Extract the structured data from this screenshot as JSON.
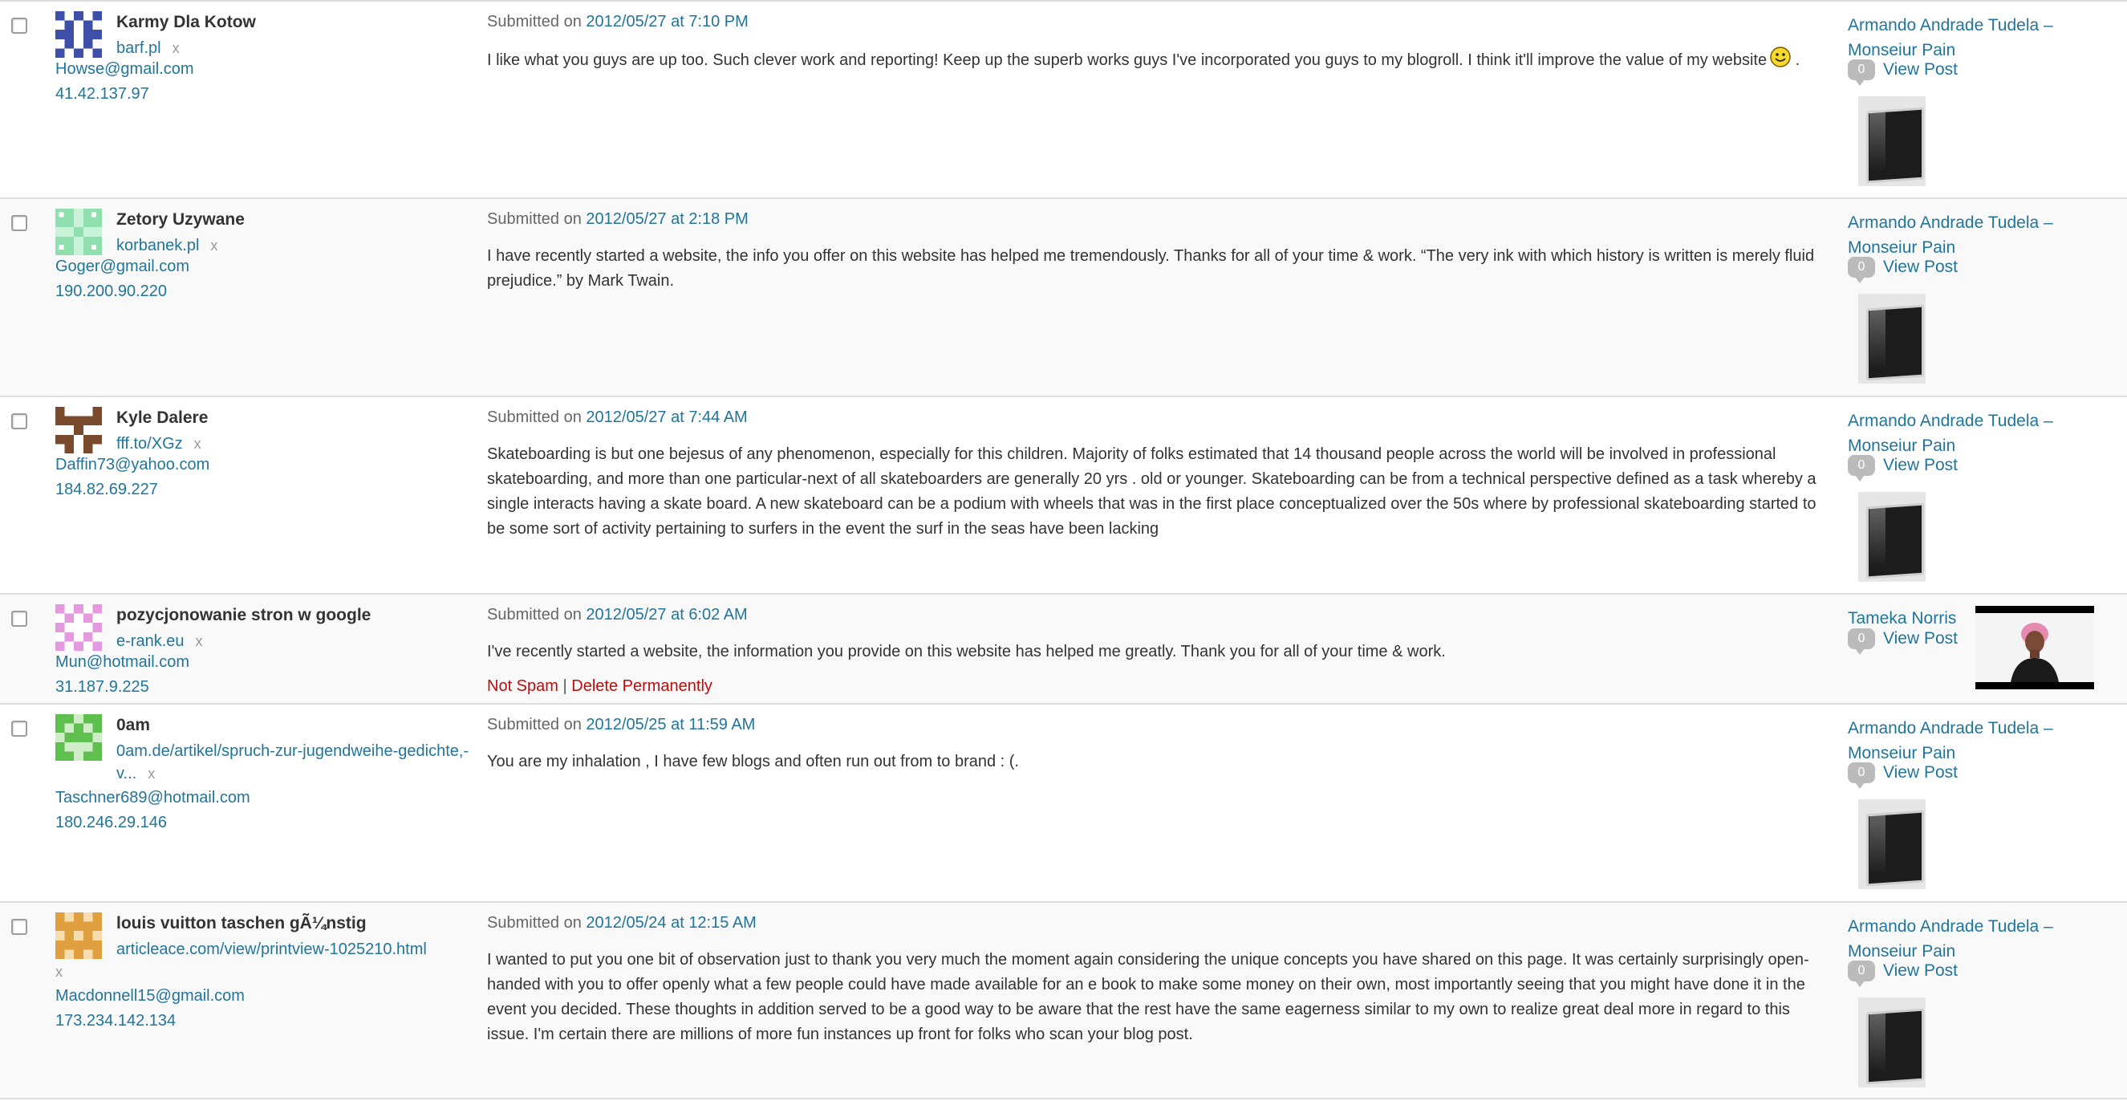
{
  "comments": [
    {
      "author": "Karmy Dla Kotow",
      "url": "barf.pl",
      "url_x": "x",
      "email": "Howse@gmail.com",
      "ip": "41.42.137.97",
      "submitted_prefix": "Submitted on",
      "date": "2012/05/27 at 7:10 PM",
      "text": "I like what you guys are up too. Such clever work and reporting! Keep up the superb works guys I've incorporated you guys to my blogroll. I think it'll improve the value of my website",
      "text_suffix": ".",
      "response_title": "Armando Andrade Tudela – Monseiur Pain",
      "response_count": "0",
      "view_post": "View Post",
      "avatar_color": "#3d4fa8"
    },
    {
      "author": "Zetory Uzywane",
      "url": "korbanek.pl",
      "url_x": "x",
      "email": "Goger@gmail.com",
      "ip": "190.200.90.220",
      "submitted_prefix": "Submitted on",
      "date": "2012/05/27 at 2:18 PM",
      "text": "I have recently started a website, the info you offer on this website has helped me tremendously. Thanks for all of your time & work. “The very ink with which history is written is merely fluid prejudice.” by Mark Twain.",
      "response_title": "Armando Andrade Tudela – Monseiur Pain",
      "response_count": "0",
      "view_post": "View Post",
      "avatar_color": "#8fe0ae"
    },
    {
      "author": "Kyle Dalere",
      "url": "fff.to/XGz",
      "url_x": "x",
      "email": "Daffin73@yahoo.com",
      "ip": "184.82.69.227",
      "submitted_prefix": "Submitted on",
      "date": "2012/05/27 at 7:44 AM",
      "text": "Skateboarding is but one bejesus of any phenomenon, especially for this children. Majority of folks estimated that 14 thousand people across the world will be involved in professional skateboarding, and more than one particular-next of all skateboarders are generally 20 yrs . old or younger. Skateboarding can be from a technical perspective defined as a task whereby a single interacts having a skate board. A new skateboard can be a podium with wheels that was in the first place conceptualized over the 50s where by professional skateboarding started to be some sort of activity pertaining to surfers in the event the surf in the seas have been lacking",
      "response_title": "Armando Andrade Tudela – Monseiur Pain",
      "response_count": "0",
      "view_post": "View Post",
      "avatar_color": "#7a4a2c"
    },
    {
      "author": "pozycjonowanie stron w google",
      "url": "e-rank.eu",
      "url_x": "x",
      "email": "Mun@hotmail.com",
      "ip": "31.187.9.225",
      "submitted_prefix": "Submitted on",
      "date": "2012/05/27 at 6:02 AM",
      "text": "I've recently started a website, the information you provide on this website has helped me greatly. Thank you for all of your time & work.",
      "not_spam": "Not Spam",
      "separator": "|",
      "delete_permanently": "Delete Permanently",
      "response_title": "Tameka Norris",
      "response_count": "0",
      "view_post": "View Post",
      "avatar_color": "#e59ae0"
    },
    {
      "author": "0am",
      "url": "0am.de/artikel/spruch-zur-jugendweihe-gedichte,-v...",
      "url_x": "x",
      "email": "Taschner689@hotmail.com",
      "ip": "180.246.29.146",
      "submitted_prefix": "Submitted on",
      "date": "2012/05/25 at 11:59 AM",
      "text": "You are my inhalation , I have few blogs and often run out from to brand : (.",
      "response_title": "Armando Andrade Tudela – Monseiur Pain",
      "response_count": "0",
      "view_post": "View Post",
      "avatar_color": "#5fbf4f"
    },
    {
      "author": "louis vuitton taschen gÃ¼nstig",
      "url": "articleace.com/view/printview-1025210.html",
      "url_x": "x",
      "email": "Macdonnell15@gmail.com",
      "ip": "173.234.142.134",
      "submitted_prefix": "Submitted on",
      "date": "2012/05/24 at 12:15 AM",
      "text": "I wanted to put you one bit of observation just to thank you very much the moment again considering the unique concepts you have shared on this page. It was certainly surprisingly open-handed with you to offer openly what a few people could have made available for an e book to make some money on their own, most importantly seeing that you might have done it in the event you decided. These thoughts in addition served to be a good way to be aware that the rest have the same eagerness similar to my own to realize great deal more in regard to this issue. I'm certain there are millions of more fun instances up front for folks who scan your blog post.",
      "response_title": "Armando Andrade Tudela – Monseiur Pain",
      "response_count": "0",
      "view_post": "View Post",
      "avatar_color": "#e0a040"
    }
  ]
}
